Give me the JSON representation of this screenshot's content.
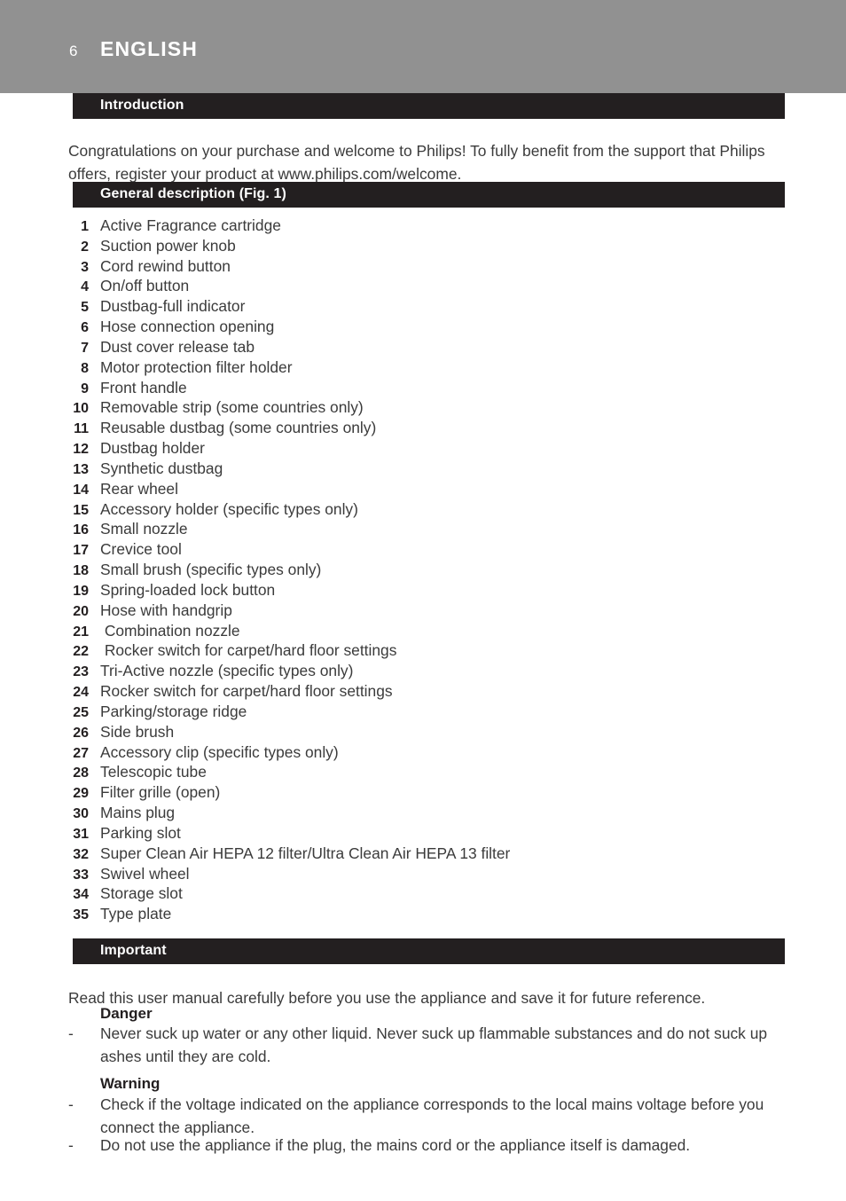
{
  "page": {
    "number": "6",
    "language": "ENGLISH",
    "header_bg": "#919191",
    "bar_bg": "#231f20",
    "body_text_color": "#3b3b3b"
  },
  "sections": {
    "introduction": {
      "bar_label": "Introduction",
      "paragraph": "Congratulations on your purchase and welcome to Philips! To fully benefit from the support that Philips offers, register your product at www.philips.com/welcome."
    },
    "general_description": {
      "bar_label": "General description (Fig. 1)",
      "parts": [
        {
          "num": "1",
          "label": "Active Fragrance cartridge"
        },
        {
          "num": "2",
          "label": "Suction power knob"
        },
        {
          "num": "3",
          "label": "Cord rewind button"
        },
        {
          "num": "4",
          "label": "On/off button"
        },
        {
          "num": "5",
          "label": "Dustbag-full indicator"
        },
        {
          "num": "6",
          "label": "Hose connection opening"
        },
        {
          "num": "7",
          "label": "Dust cover release tab"
        },
        {
          "num": "8",
          "label": "Motor protection filter holder"
        },
        {
          "num": "9",
          "label": "Front handle"
        },
        {
          "num": "10",
          "label": "Removable strip (some countries only)"
        },
        {
          "num": "11",
          "label": "Reusable dustbag (some countries only)"
        },
        {
          "num": "12",
          "label": "Dustbag holder"
        },
        {
          "num": "13",
          "label": "Synthetic dustbag"
        },
        {
          "num": "14",
          "label": "Rear wheel"
        },
        {
          "num": "15",
          "label": "Accessory holder (specific types only)"
        },
        {
          "num": "16",
          "label": "Small nozzle"
        },
        {
          "num": "17",
          "label": "Crevice tool"
        },
        {
          "num": "18",
          "label": "Small brush (specific types only)"
        },
        {
          "num": "19",
          "label": "Spring-loaded lock button"
        },
        {
          "num": "20",
          "label": "Hose with handgrip"
        },
        {
          "num": "21",
          "label": " Combination nozzle"
        },
        {
          "num": "22",
          "label": " Rocker switch for carpet/hard floor settings"
        },
        {
          "num": "23",
          "label": "Tri-Active nozzle (specific types only)"
        },
        {
          "num": "24",
          "label": "Rocker switch for carpet/hard floor settings"
        },
        {
          "num": "25",
          "label": "Parking/storage ridge"
        },
        {
          "num": "26",
          "label": "Side brush"
        },
        {
          "num": "27",
          "label": "Accessory clip (specific types only)"
        },
        {
          "num": "28",
          "label": "Telescopic tube"
        },
        {
          "num": "29",
          "label": "Filter grille (open)"
        },
        {
          "num": "30",
          "label": "Mains plug"
        },
        {
          "num": "31",
          "label": "Parking slot"
        },
        {
          "num": "32",
          "label": "Super Clean Air HEPA 12 filter/Ultra Clean Air HEPA 13 filter"
        },
        {
          "num": "33",
          "label": "Swivel wheel"
        },
        {
          "num": "34",
          "label": "Storage slot"
        },
        {
          "num": "35",
          "label": "Type plate"
        }
      ]
    },
    "important": {
      "bar_label": "Important",
      "paragraph": "Read this user manual carefully before you use the appliance and save it for future reference.",
      "danger": {
        "heading": "Danger",
        "dash": "-",
        "bullets": [
          "Never suck up water or any other liquid. Never suck up flammable substances and do not suck up ashes until they are cold."
        ]
      },
      "warning": {
        "heading": "Warning",
        "dash": "-",
        "bullets": [
          "Check if the voltage indicated on the appliance corresponds to the local mains voltage before you connect the appliance.",
          "Do not use the appliance if the plug, the mains cord or the appliance itself is damaged."
        ]
      }
    }
  }
}
